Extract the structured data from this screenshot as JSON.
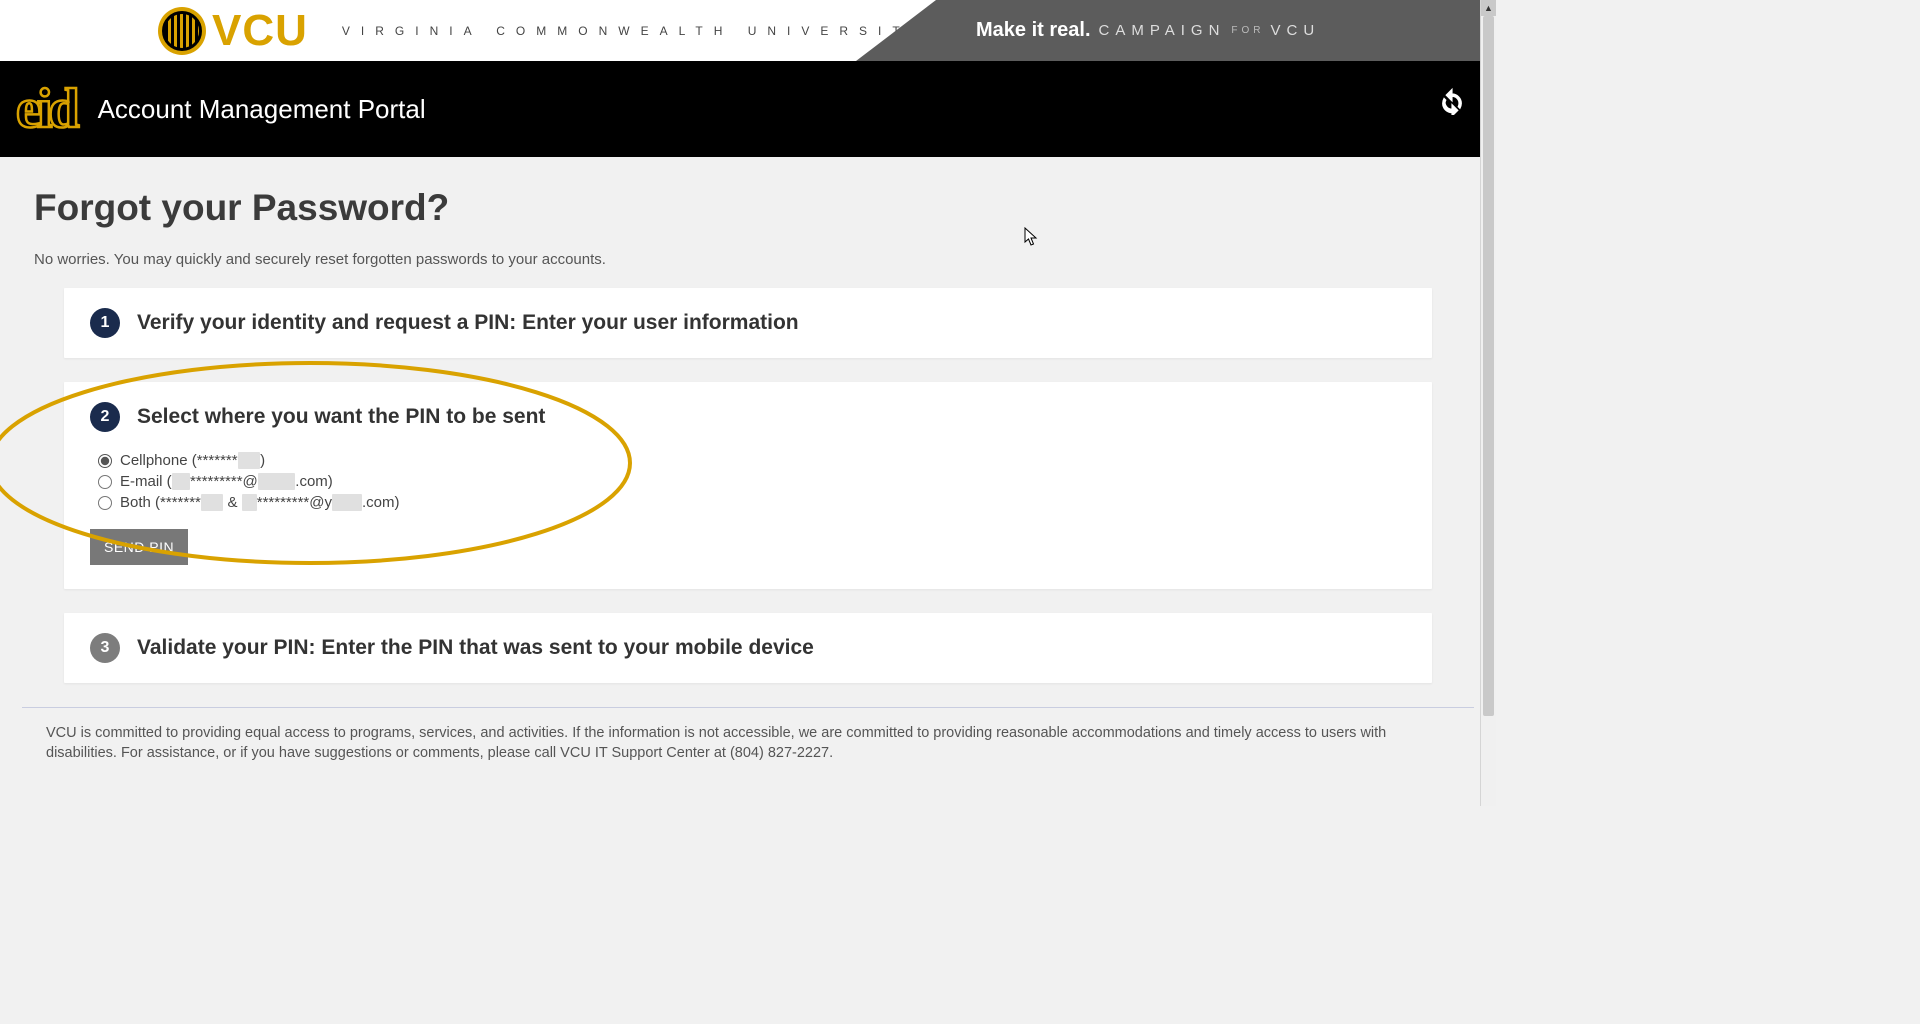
{
  "top_banner": {
    "logo_text": "VCU",
    "full_name": "VIRGINIA COMMONWEALTH UNIVERSITY",
    "make_it_real": "Make it real.",
    "campaign": "CAMPAIGN",
    "for": "FOR",
    "vcu": "VCU"
  },
  "header": {
    "eid_logo_text": "eid",
    "portal_title": "Account Management Portal"
  },
  "page": {
    "title": "Forgot your Password?",
    "subtitle": "No worries. You may quickly and securely reset forgotten passwords to your accounts."
  },
  "steps": {
    "s1": {
      "num": "1",
      "title": "Verify your identity and request a PIN: Enter your user information"
    },
    "s2": {
      "num": "2",
      "title": "Select where you want the PIN to be sent",
      "opt_cell_pre": "Cellphone (*******",
      "opt_cell_redacted": "xxx",
      "opt_cell_post": ")",
      "opt_email_pre": "E-mail (",
      "opt_email_r1": "jxx",
      "opt_email_mid": "*********@",
      "opt_email_r2": "xxxxx",
      "opt_email_post": ".com)",
      "opt_both_pre": "Both (*******",
      "opt_both_r1": "xxx",
      "opt_both_mid1": " & ",
      "opt_both_r2": "xx",
      "opt_both_mid2": "*********@y",
      "opt_both_r3": "xxxx",
      "opt_both_post": ".com)",
      "send_btn": "SEND PIN"
    },
    "s3": {
      "num": "3",
      "title": "Validate your PIN: Enter the PIN that was sent to your mobile device"
    }
  },
  "footer": {
    "text": "VCU is committed to providing equal access to programs, services, and activities. If the information is not accessible, we are committed to providing reasonable accommodations and timely access to users with disabilities. For assistance, or if you have suggestions or comments, please call VCU IT Support Center at (804) 827-2227."
  }
}
